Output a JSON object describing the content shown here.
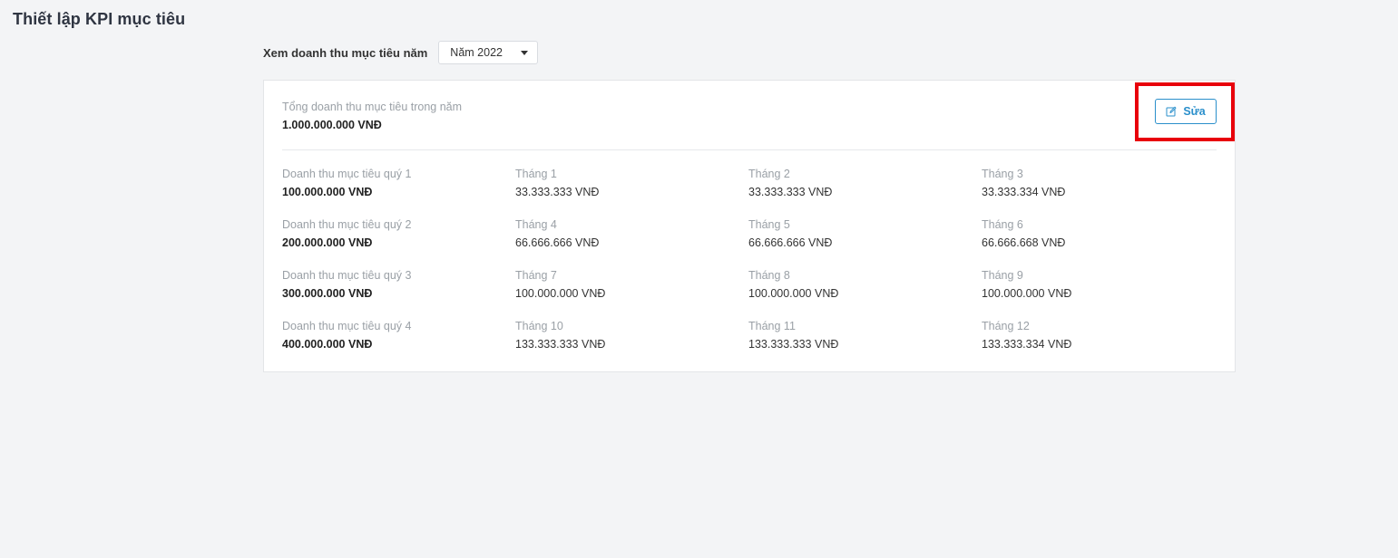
{
  "page": {
    "title": "Thiết lập KPI mục tiêu"
  },
  "filter": {
    "label": "Xem doanh thu mục tiêu năm",
    "selected_year": "Năm 2022"
  },
  "summary": {
    "label": "Tổng doanh thu mục tiêu trong năm",
    "value": "1.000.000.000 VNĐ",
    "edit_label": "Sửa"
  },
  "quarters": [
    {
      "label": "Doanh thu mục tiêu quý 1",
      "value": "100.000.000 VNĐ",
      "months": [
        {
          "label": "Tháng 1",
          "value": "33.333.333 VNĐ"
        },
        {
          "label": "Tháng 2",
          "value": "33.333.333 VNĐ"
        },
        {
          "label": "Tháng 3",
          "value": "33.333.334 VNĐ"
        }
      ]
    },
    {
      "label": "Doanh thu mục tiêu quý 2",
      "value": "200.000.000 VNĐ",
      "months": [
        {
          "label": "Tháng 4",
          "value": "66.666.666 VNĐ"
        },
        {
          "label": "Tháng 5",
          "value": "66.666.666 VNĐ"
        },
        {
          "label": "Tháng 6",
          "value": "66.666.668 VNĐ"
        }
      ]
    },
    {
      "label": "Doanh thu mục tiêu quý 3",
      "value": "300.000.000 VNĐ",
      "months": [
        {
          "label": "Tháng 7",
          "value": "100.000.000 VNĐ"
        },
        {
          "label": "Tháng 8",
          "value": "100.000.000 VNĐ"
        },
        {
          "label": "Tháng 9",
          "value": "100.000.000 VNĐ"
        }
      ]
    },
    {
      "label": "Doanh thu mục tiêu quý 4",
      "value": "400.000.000 VNĐ",
      "months": [
        {
          "label": "Tháng 10",
          "value": "133.333.333 VNĐ"
        },
        {
          "label": "Tháng 11",
          "value": "133.333.333 VNĐ"
        },
        {
          "label": "Tháng 12",
          "value": "133.333.334 VNĐ"
        }
      ]
    }
  ],
  "colors": {
    "accent": "#2a8fcb",
    "highlight": "#e8000b",
    "background": "#f3f4f6"
  },
  "icons": {
    "edit": "edit-icon",
    "dropdown": "chevron-down-icon"
  }
}
